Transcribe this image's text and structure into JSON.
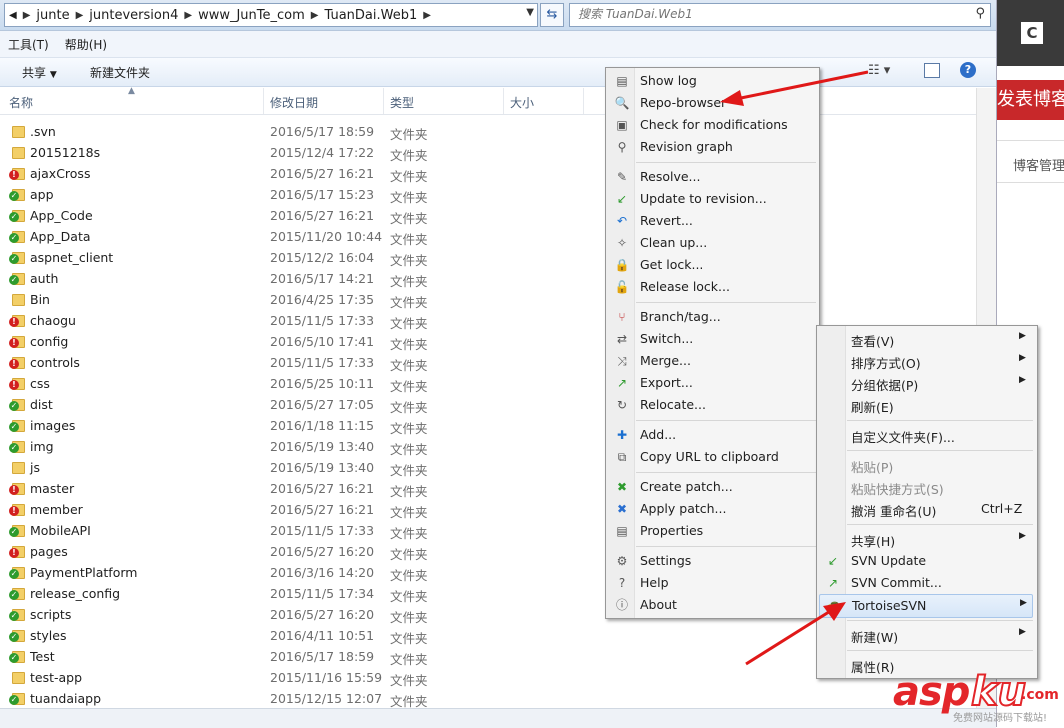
{
  "address": {
    "crumbs": [
      "junte",
      "junteversion4",
      "www_JunTe_com",
      "TuanDai.Web1"
    ],
    "search_placeholder": "搜索 TuanDai.Web1"
  },
  "menubar": [
    "工具(T)",
    "帮助(H)"
  ],
  "toolbar": {
    "share": "共享",
    "new_folder": "新建文件夹"
  },
  "columns": {
    "name": "名称",
    "modified": "修改日期",
    "type": "类型",
    "size": "大小"
  },
  "files": [
    {
      "name": ".svn",
      "date": "2016/5/17 18:59",
      "type": "文件夹",
      "status": "none"
    },
    {
      "name": "20151218s",
      "date": "2015/12/4 17:22",
      "type": "文件夹",
      "status": "none"
    },
    {
      "name": "ajaxCross",
      "date": "2016/5/27 16:21",
      "type": "文件夹",
      "status": "modified"
    },
    {
      "name": "app",
      "date": "2016/5/17 15:23",
      "type": "文件夹",
      "status": "ok"
    },
    {
      "name": "App_Code",
      "date": "2016/5/27 16:21",
      "type": "文件夹",
      "status": "ok"
    },
    {
      "name": "App_Data",
      "date": "2015/11/20 10:44",
      "type": "文件夹",
      "status": "ok"
    },
    {
      "name": "aspnet_client",
      "date": "2015/12/2 16:04",
      "type": "文件夹",
      "status": "ok"
    },
    {
      "name": "auth",
      "date": "2016/5/17 14:21",
      "type": "文件夹",
      "status": "ok"
    },
    {
      "name": "Bin",
      "date": "2016/4/25 17:35",
      "type": "文件夹",
      "status": "none"
    },
    {
      "name": "chaogu",
      "date": "2015/11/5 17:33",
      "type": "文件夹",
      "status": "modified"
    },
    {
      "name": "config",
      "date": "2016/5/10 17:41",
      "type": "文件夹",
      "status": "modified"
    },
    {
      "name": "controls",
      "date": "2015/11/5 17:33",
      "type": "文件夹",
      "status": "modified"
    },
    {
      "name": "css",
      "date": "2016/5/25 10:11",
      "type": "文件夹",
      "status": "modified"
    },
    {
      "name": "dist",
      "date": "2016/5/27 17:05",
      "type": "文件夹",
      "status": "ok"
    },
    {
      "name": "images",
      "date": "2016/1/18 11:15",
      "type": "文件夹",
      "status": "ok"
    },
    {
      "name": "img",
      "date": "2016/5/19 13:40",
      "type": "文件夹",
      "status": "ok"
    },
    {
      "name": "js",
      "date": "2016/5/19 13:40",
      "type": "文件夹",
      "status": "none"
    },
    {
      "name": "master",
      "date": "2016/5/27 16:21",
      "type": "文件夹",
      "status": "modified"
    },
    {
      "name": "member",
      "date": "2016/5/27 16:21",
      "type": "文件夹",
      "status": "modified"
    },
    {
      "name": "MobileAPI",
      "date": "2015/11/5 17:33",
      "type": "文件夹",
      "status": "ok"
    },
    {
      "name": "pages",
      "date": "2016/5/27 16:20",
      "type": "文件夹",
      "status": "modified"
    },
    {
      "name": "PaymentPlatform",
      "date": "2016/3/16 14:20",
      "type": "文件夹",
      "status": "ok"
    },
    {
      "name": "release_config",
      "date": "2015/11/5 17:34",
      "type": "文件夹",
      "status": "ok"
    },
    {
      "name": "scripts",
      "date": "2016/5/27 16:20",
      "type": "文件夹",
      "status": "ok"
    },
    {
      "name": "styles",
      "date": "2016/4/11 10:51",
      "type": "文件夹",
      "status": "ok"
    },
    {
      "name": "Test",
      "date": "2016/5/17 18:59",
      "type": "文件夹",
      "status": "ok"
    },
    {
      "name": "test-app",
      "date": "2015/11/16 15:59",
      "type": "文件夹",
      "status": "none"
    },
    {
      "name": "tuandaiapp",
      "date": "2015/12/15 12:07",
      "type": "文件夹",
      "status": "ok"
    }
  ],
  "svn_menu": [
    {
      "label": "Show log",
      "icon": "log-icon"
    },
    {
      "label": "Repo-browser",
      "icon": "repo-browser-icon"
    },
    {
      "label": "Check for modifications",
      "icon": "check-modifications-icon"
    },
    {
      "label": "Revision graph",
      "icon": "revision-graph-icon"
    },
    {
      "label": "Resolve...",
      "icon": "resolve-icon"
    },
    {
      "label": "Update to revision...",
      "icon": "update-revision-icon"
    },
    {
      "label": "Revert...",
      "icon": "revert-icon"
    },
    {
      "label": "Clean up...",
      "icon": "cleanup-icon"
    },
    {
      "label": "Get lock...",
      "icon": "lock-icon"
    },
    {
      "label": "Release lock...",
      "icon": "unlock-icon"
    },
    {
      "label": "Branch/tag...",
      "icon": "branch-icon"
    },
    {
      "label": "Switch...",
      "icon": "switch-icon"
    },
    {
      "label": "Merge...",
      "icon": "merge-icon"
    },
    {
      "label": "Export...",
      "icon": "export-icon"
    },
    {
      "label": "Relocate...",
      "icon": "relocate-icon"
    },
    {
      "label": "Add...",
      "icon": "add-icon"
    },
    {
      "label": "Copy URL to clipboard",
      "icon": "copy-url-icon"
    },
    {
      "label": "Create patch...",
      "icon": "create-patch-icon"
    },
    {
      "label": "Apply patch...",
      "icon": "apply-patch-icon"
    },
    {
      "label": "Properties",
      "icon": "properties-icon"
    },
    {
      "label": "Settings",
      "icon": "settings-icon"
    },
    {
      "label": "Help",
      "icon": "help-icon"
    },
    {
      "label": "About",
      "icon": "about-icon"
    }
  ],
  "context_menu": [
    {
      "label": "查看(V)",
      "arrow": true
    },
    {
      "label": "排序方式(O)",
      "arrow": true
    },
    {
      "label": "分组依据(P)",
      "arrow": true
    },
    {
      "label": "刷新(E)"
    },
    {
      "label": "自定义文件夹(F)..."
    },
    {
      "label": "粘贴(P)",
      "disabled": true
    },
    {
      "label": "粘贴快捷方式(S)",
      "disabled": true
    },
    {
      "label": "撤消 重命名(U)",
      "shortcut": "Ctrl+Z"
    },
    {
      "label": "共享(H)",
      "arrow": true
    },
    {
      "label": "SVN Update"
    },
    {
      "label": "SVN Commit..."
    },
    {
      "label": "TortoiseSVN",
      "arrow": true,
      "highlighted": true
    },
    {
      "label": "新建(W)",
      "arrow": true
    },
    {
      "label": "属性(R)"
    }
  ],
  "background_page": {
    "red_banner": "发表博客",
    "manage_text": "博客管理"
  },
  "watermark": {
    "asp": "asp",
    "ku": "ku",
    "com": ".com",
    "sub": "免费网站源码下载站!"
  },
  "colors": {
    "accent_red": "#e3262a",
    "svn_ok": "#2e9b2e",
    "svn_modified": "#d22020",
    "arrow": "#e01818"
  }
}
